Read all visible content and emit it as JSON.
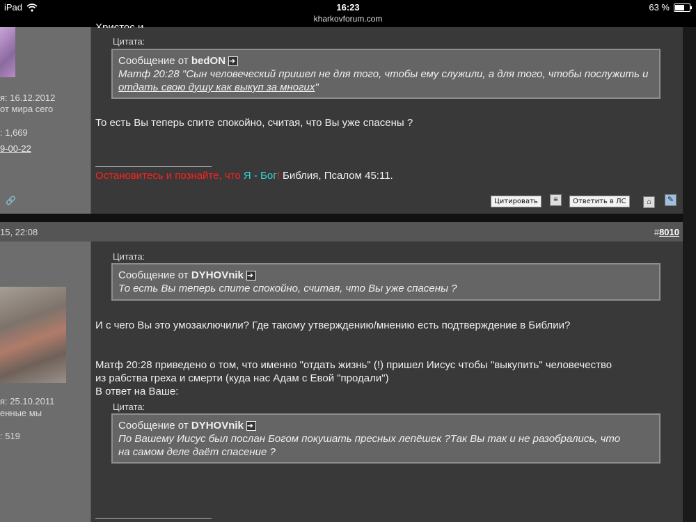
{
  "statusbar": {
    "device": "iPad",
    "time": "16:23",
    "url": "kharkovforum.com",
    "battery": "63 %",
    "battery_level": 0.63
  },
  "post1": {
    "title_partial": "Христос и.",
    "left": {
      "joined": "я: 16.12.2012",
      "location": "от мира сего",
      "posts": ": 1,669",
      "link": "9-00-22",
      "icon": "🔗"
    },
    "quote_label": "Цитата:",
    "quote_from_prefix": "Сообщение от ",
    "quote_author": "bedON",
    "quote_text": "Матф 20:28 \"Сын человеческий пришел не для того, чтобы ему служили, а для того, чтобы послужить и ",
    "quote_link": "отдать свою душу как выкуп за многих",
    "quote_tail": "\"",
    "body": "То есть Вы теперь спите спокойно, считая, что Вы уже спасены ?",
    "signature": {
      "part1": "Остановитесь и познайте, что ",
      "part2": "Я - Бог",
      "part3": "! ",
      "part4": "Библия, Псалом 45:11."
    },
    "buttons": {
      "quote": "Цитировать",
      "pm": "Ответить в ЛС"
    }
  },
  "post2": {
    "date": "15, 22:08",
    "number_prefix": "#",
    "number": "8010",
    "left": {
      "joined": "я: 25.10.2011",
      "location": "енные мы",
      "posts": ": 519"
    },
    "quote1": {
      "label": "Цитата:",
      "prefix": "Сообщение от ",
      "author": "DYHOVnik",
      "text": "То есть Вы теперь спите спокойно, считая, что Вы уже спасены ?"
    },
    "body1": "И с чего Вы это умозаключили? Где такому утверждению/мнению есть подтверждение в Библии?",
    "body2_line1": "Матф 20:28 приведено о том, что именно \"отдать жизнь\" (!) пришел Иисус чтобы \"выкупить\" человечество",
    "body2_line2": "из рабства греха и смерти (куда нас Адам с Евой \"продали\")",
    "body3": "В ответ на Ваше:",
    "quote2": {
      "label": "Цитата:",
      "prefix": "Сообщение от ",
      "author": "DYHOVnik",
      "text_line1": "По Вашему Иисус был послан Богом покушать пресных лепёшек ?Так Вы так и не разобрались, что",
      "text_line2": "на самом деле даёт спасение ?"
    }
  }
}
